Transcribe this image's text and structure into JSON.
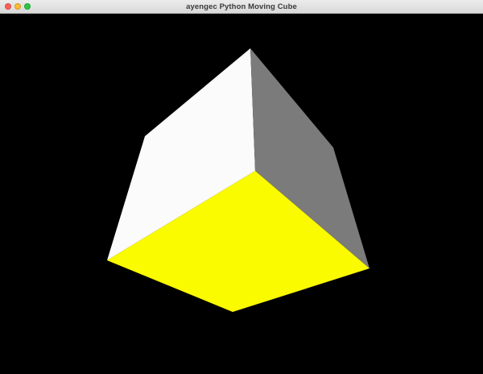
{
  "window": {
    "title": "ayengec Python Moving Cube",
    "controls": {
      "close_color": "#ff5f57",
      "minimize_color": "#febc2e",
      "zoom_color": "#28c840",
      "close_icon": "close-icon",
      "minimize_icon": "minimize-icon",
      "zoom_icon": "zoom-icon"
    }
  },
  "scene": {
    "background_color": "#000000",
    "cube": {
      "faces": [
        {
          "name": "top-face",
          "color": "#fbfbfb"
        },
        {
          "name": "right-face",
          "color": "#7b7b7b"
        },
        {
          "name": "bottom-face",
          "color": "#fbfb00"
        }
      ]
    }
  }
}
